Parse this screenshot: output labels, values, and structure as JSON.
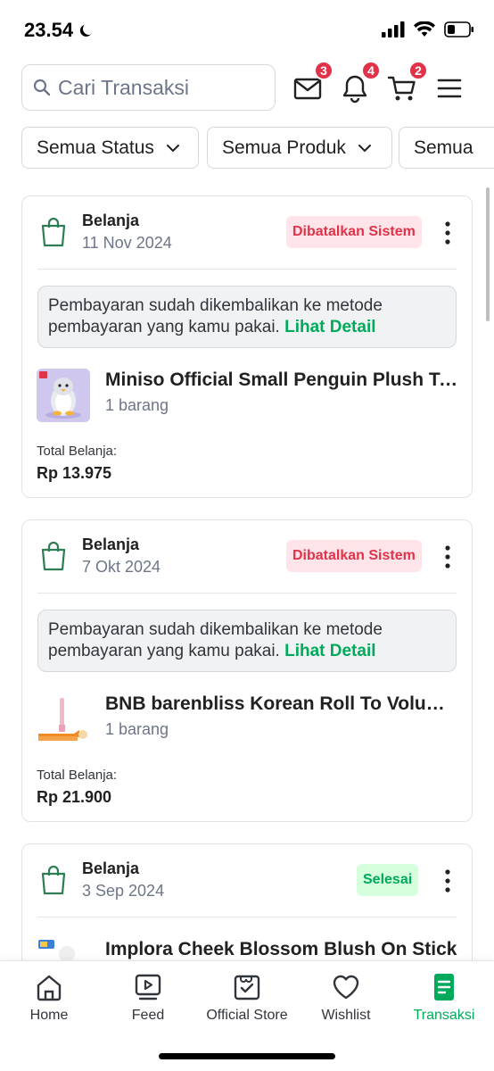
{
  "status_bar": {
    "time": "23.54"
  },
  "search": {
    "placeholder": "Cari Transaksi"
  },
  "header": {
    "mail_badge": "3",
    "notif_badge": "4",
    "cart_badge": "2"
  },
  "filters": [
    "Semua Status",
    "Semua Produk",
    "Semua"
  ],
  "transactions": [
    {
      "type": "Belanja",
      "date": "11 Nov 2024",
      "status": "Dibatalkan Sistem",
      "notice_text": "Pembayaran sudah dikembalikan ke metode pembayaran yang kamu pakai.",
      "notice_link": "Lihat Detail",
      "product_name": "Miniso Official Small Penguin Plush Toy",
      "qty": "1 barang",
      "total_label": "Total Belanja:",
      "total_value": "Rp 13.975"
    },
    {
      "type": "Belanja",
      "date": "7 Okt 2024",
      "status": "Dibatalkan Sistem",
      "notice_text": "Pembayaran sudah dikembalikan ke metode pembayaran yang kamu pakai.",
      "notice_link": "Lihat Detail",
      "product_name": "BNB barenbliss Korean Roll To Volume Mascara",
      "qty": "1 barang",
      "total_label": "Total Belanja:",
      "total_value": "Rp 21.900"
    },
    {
      "type": "Belanja",
      "date": "3 Sep 2024",
      "status": "Selesai",
      "product_name": "Implora Cheek Blossom Blush On Stick"
    }
  ],
  "nav": {
    "home": "Home",
    "feed": "Feed",
    "official_store": "Official Store",
    "wishlist": "Wishlist",
    "transaksi": "Transaksi"
  },
  "colors": {
    "accent": "#00aa5b",
    "danger": "#e0334a",
    "danger_bg": "#ffe5e9",
    "success_bg": "#d6ffde"
  }
}
